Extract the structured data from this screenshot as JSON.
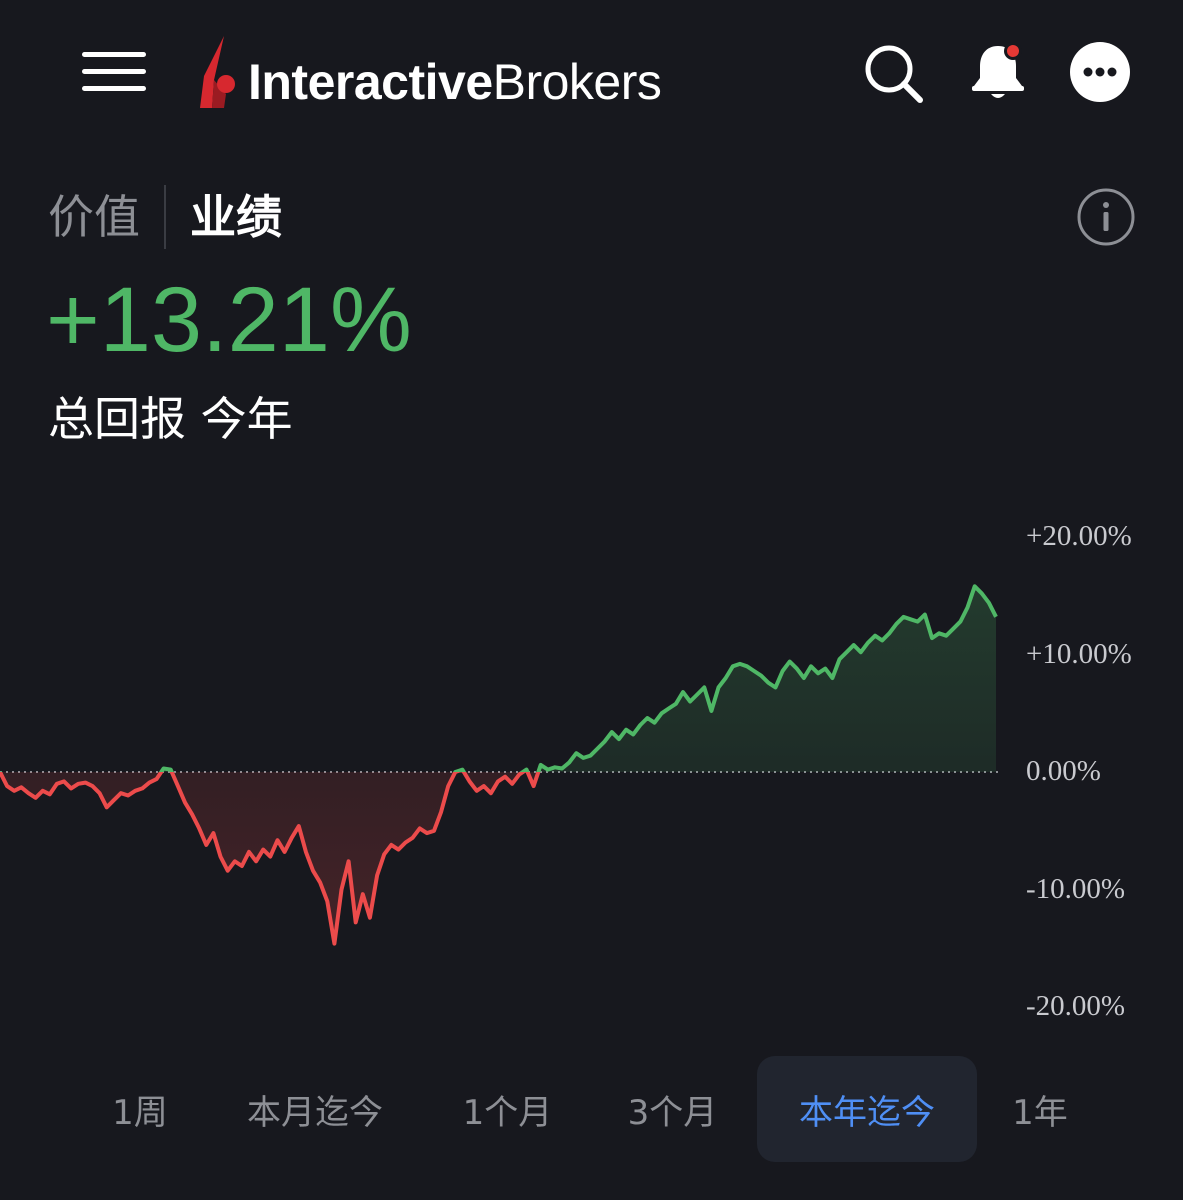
{
  "header": {
    "logo_bold": "Interactive",
    "logo_regular": "Brokers",
    "icons": [
      "menu-icon",
      "search-icon",
      "bell-icon",
      "more-icon"
    ],
    "notification_dot_color": "#e53935"
  },
  "tabs": [
    {
      "label": "价值",
      "active": false
    },
    {
      "label": "业绩",
      "active": true
    }
  ],
  "summary": {
    "value": "+13.21%",
    "label": "总回报 今年",
    "color": "#4fb766"
  },
  "chart_data": {
    "type": "line",
    "title": "",
    "xlabel": "",
    "ylabel": "",
    "ylim": [
      -20,
      20
    ],
    "y_ticks": [
      "+20.00%",
      "+10.00%",
      "0.00%",
      "-10.00%",
      "-20.00%"
    ],
    "y_tick_values": [
      20,
      10,
      0,
      -10,
      -20
    ],
    "baseline": 0,
    "positive_color": "#4fb766",
    "negative_color": "#ec4b4b",
    "grid": false,
    "series": [
      {
        "values": [
          0.0,
          -1.2,
          -1.6,
          -1.3,
          -1.8,
          -2.2,
          -1.6,
          -1.9,
          -1.0,
          -0.8,
          -1.4,
          -1.0,
          -0.9,
          -1.2,
          -1.8,
          -3.0,
          -2.4,
          -1.8,
          -2.0,
          -1.6,
          -1.4,
          -0.9,
          -0.6,
          0.3,
          0.2,
          -1.2,
          -2.6,
          -3.6,
          -4.8,
          -6.2,
          -5.2,
          -7.2,
          -8.4,
          -7.6,
          -8.0,
          -6.8,
          -7.6,
          -6.6,
          -7.2,
          -5.8,
          -6.8,
          -5.6,
          -4.6,
          -6.8,
          -8.4,
          -9.4,
          -11.0,
          -14.6,
          -10.0,
          -7.6,
          -12.8,
          -10.4,
          -12.4,
          -8.8,
          -7.0,
          -6.2,
          -6.6,
          -6.0,
          -5.6,
          -4.8,
          -5.2,
          -5.0,
          -3.4,
          -1.2,
          0.0,
          0.2,
          -0.8,
          -1.6,
          -1.2,
          -1.8,
          -0.8,
          -0.4,
          -1.0,
          -0.2,
          0.2,
          -1.2,
          0.6,
          0.2,
          0.4,
          0.3,
          0.8,
          1.6,
          1.2,
          1.4,
          2.0,
          2.6,
          3.4,
          2.8,
          3.6,
          3.2,
          4.0,
          4.6,
          4.2,
          5.0,
          5.4,
          5.8,
          6.8,
          6.0,
          6.6,
          7.2,
          5.2,
          7.2,
          8.0,
          9.0,
          9.2,
          9.0,
          8.6,
          8.2,
          7.6,
          7.2,
          8.6,
          9.4,
          8.8,
          8.0,
          9.0,
          8.4,
          8.8,
          8.0,
          9.6,
          10.2,
          10.8,
          10.2,
          11.0,
          11.6,
          11.2,
          11.8,
          12.6,
          13.2,
          13.0,
          12.8,
          13.4,
          11.4,
          11.8,
          11.6,
          12.2,
          12.8,
          14.0,
          15.8,
          15.2,
          14.4,
          13.21
        ]
      }
    ]
  },
  "range_selector": [
    {
      "label": "1周",
      "active": false
    },
    {
      "label": "本月迄今",
      "active": false
    },
    {
      "label": "1个月",
      "active": false
    },
    {
      "label": "3个月",
      "active": false
    },
    {
      "label": "本年迄今",
      "active": true
    },
    {
      "label": "1年",
      "active": false
    }
  ]
}
